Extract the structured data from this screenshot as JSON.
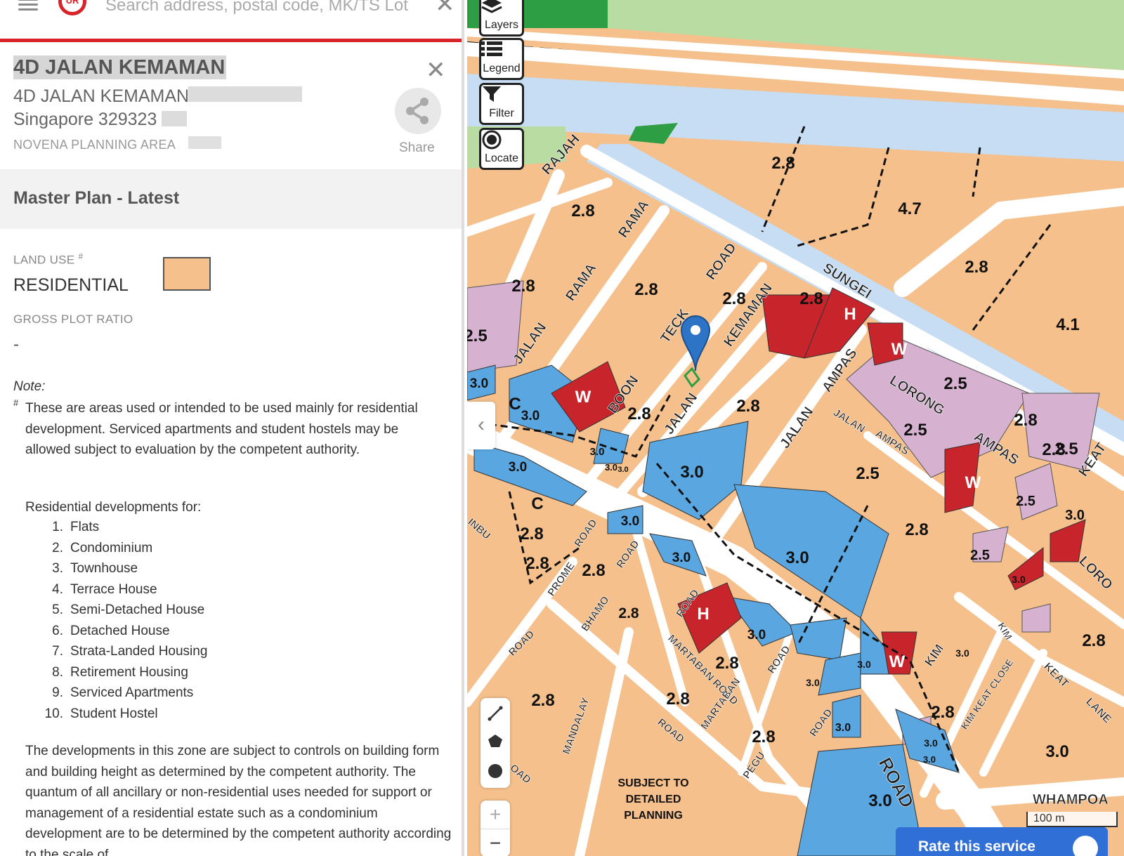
{
  "search": {
    "placeholder": "Search address, postal code, MK/TS Lot"
  },
  "place": {
    "title": "4D JALAN KEMAMAN",
    "address_line1": "4D JALAN KEMAMAN",
    "address_line2": "Singapore 329323",
    "planning_area": "NOVENA PLANNING AREA",
    "share_label": "Share"
  },
  "master_plan": {
    "title": "Master Plan - Latest",
    "land_use_label": "LAND USE",
    "land_use_value": "RESIDENTIAL",
    "land_use_color": "#f5c08c",
    "gpr_label": "GROSS PLOT RATIO",
    "gpr_value": "-"
  },
  "note": {
    "label": "Note:",
    "hash": "#",
    "text": "These are areas used or intended to be used mainly for residential development. Serviced apartments and student hostels may be allowed subject to evaluation by the competent authority.",
    "residential_intro": "Residential developments for:",
    "residential_types": [
      "Flats",
      "Condominium",
      "Townhouse",
      "Terrace House",
      "Semi-Detached House",
      "Detached House",
      "Strata-Landed Housing",
      "Retirement Housing",
      "Serviced Apartments",
      "Student Hostel"
    ],
    "development_text": "The developments in this zone are subject to controls on building form and building height as determined by the competent authority. The quantum of all ancillary or non-residential uses needed for support or management of a residential estate such as a condominium development are to be determined by the competent authority according to the scale of"
  },
  "map_controls": {
    "layers": "Layers",
    "legend": "Legend",
    "filter": "Filter",
    "locate": "Locate",
    "zoom_in": "+",
    "zoom_out": "−",
    "collapse": "‹"
  },
  "map": {
    "colors": {
      "residential": "#f5c08c",
      "commercial": "#5aa6e0",
      "white": "#c8242c",
      "mixed": "#d7b2d0",
      "park": "#2e9e44",
      "open_space": "#b9dca3",
      "waterbody": "#c6ddf3"
    },
    "road_labels": [
      "RAJAH",
      "RAMA",
      "RAMA",
      "JALAN",
      "SUNGEI",
      "ROAD",
      "KEMAMAN",
      "TECK",
      "JALAN",
      "BOON",
      "JALAN",
      "AMPAS",
      "LORONG",
      "JALAN",
      "AMPAS",
      "AMPAS",
      "KEAT",
      "LORO",
      "PROME",
      "ROAD",
      "ROAD",
      "BHAMO",
      "ROAD",
      "MARTABAN ROAD",
      "ROAD",
      "MARTABAN",
      "PEGU",
      "ROAD",
      "MANDALAY",
      "ROAD",
      "ROAD",
      "ROAD",
      "INBU",
      "OAD",
      "KIM",
      "KIM",
      "KIM KEAT CLOSE",
      "KEAT",
      "LANE",
      "WHAMPOA"
    ],
    "plot_labels": [
      "2.8",
      "4.7",
      "2.8",
      "2.8",
      "2.8",
      "2.8",
      "2.8",
      "2.8",
      "4.1",
      "2.5",
      "3.0",
      "C",
      "3.0",
      "W",
      "2.8",
      "2.8",
      "W",
      "2.5",
      "2.8",
      "2.5",
      "2.5",
      "2.8",
      "2.5",
      "3.0",
      "3.0",
      "3.0",
      "3.0",
      "C",
      "2.8",
      "3.0",
      "W",
      "2.5",
      "3.0",
      "2.8",
      "3.0",
      "2.8",
      "3.0",
      "2.5",
      "3.0",
      "2.8",
      "3.0",
      "2.8",
      "2.8",
      "2.8",
      "2.8",
      "3.0",
      "3.0",
      "3.0",
      "3.0",
      "2.8",
      "3.0",
      "W",
      "3.0",
      "2.8",
      "3.0",
      "3.0",
      "3.0",
      "2.8",
      "8",
      "H",
      "H",
      "3"
    ],
    "notice": [
      "SUBJECT TO",
      "DETAILED",
      "PLANNING"
    ],
    "scale": "100 m"
  },
  "rate": {
    "label": "Rate this service"
  }
}
